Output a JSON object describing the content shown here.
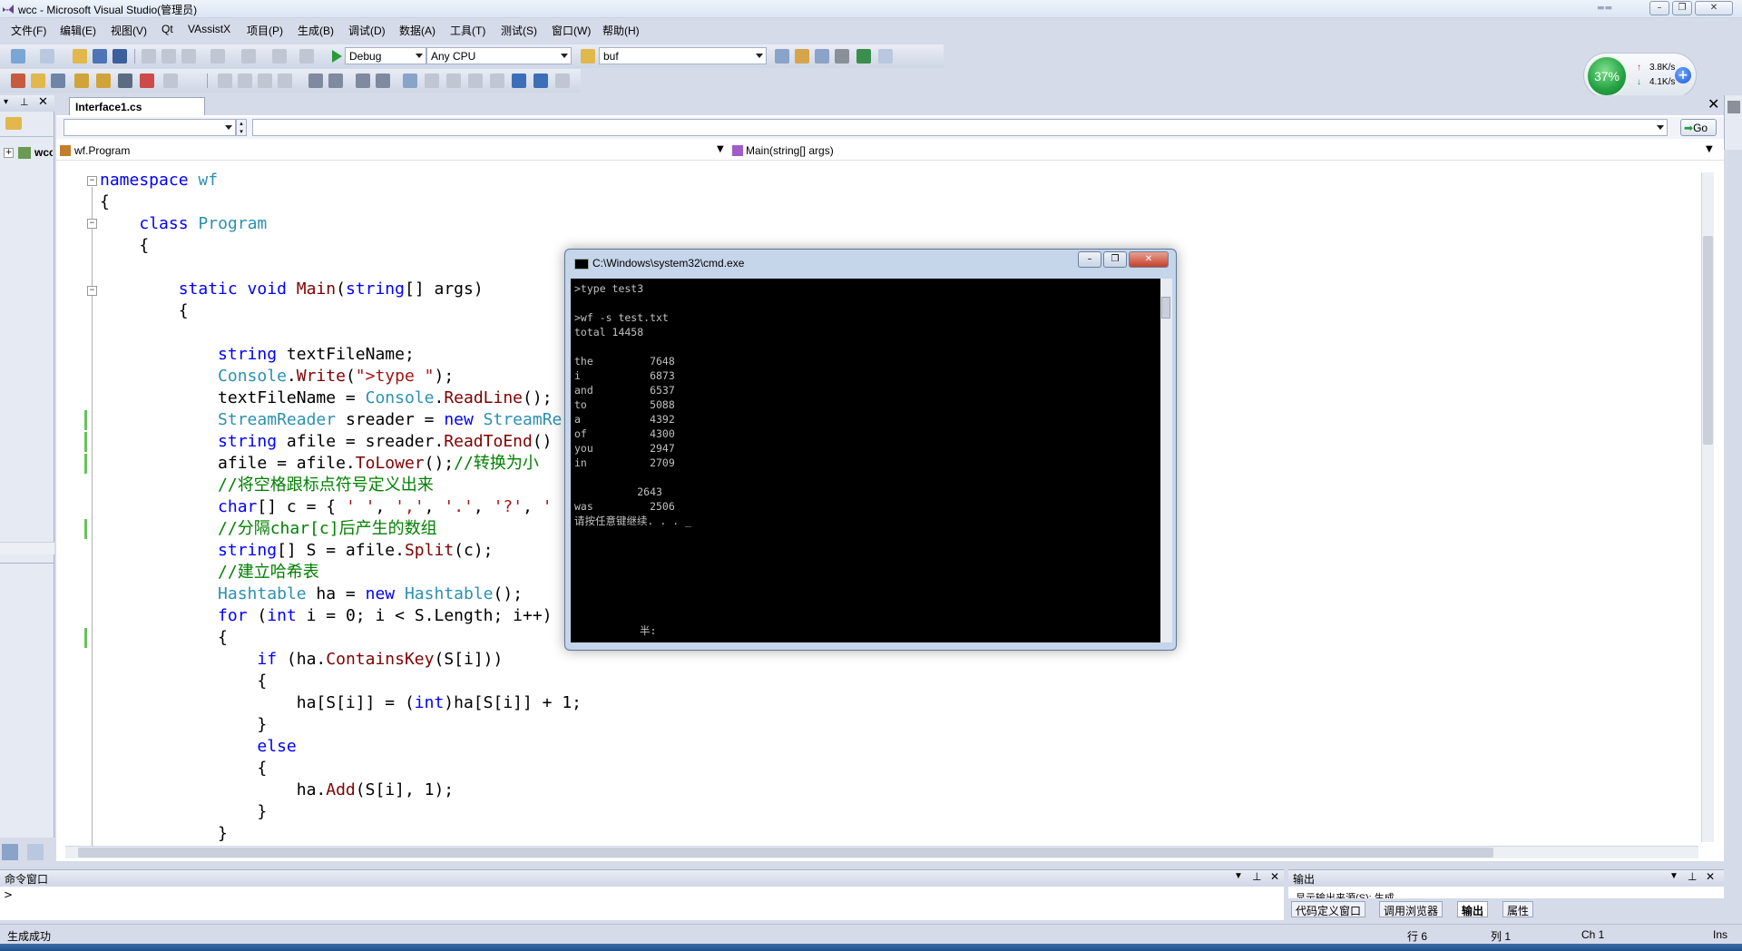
{
  "window": {
    "title": "wcc - Microsoft Visual Studio(管理员)"
  },
  "menu": [
    "文件(F)",
    "编辑(E)",
    "视图(V)",
    "Qt",
    "VAssistX",
    "项目(P)",
    "生成(B)",
    "调试(D)",
    "数据(A)",
    "工具(T)",
    "测试(S)",
    "窗口(W)",
    "帮助(H)"
  ],
  "toolbar": {
    "config": "Debug",
    "platform": "Any CPU",
    "find_value": "buf"
  },
  "gauge": {
    "percent": "37%",
    "upload": "3.8K/s",
    "download": "4.1K/s"
  },
  "editor": {
    "tab": "Interface1.cs",
    "class_combo": "wf.Program",
    "member_combo": "Main(string[] args)",
    "go_label": "Go"
  },
  "solution": {
    "root_label": "wcc"
  },
  "code_lines": [
    [
      [
        "kw",
        "namespace "
      ],
      [
        "ty",
        "wf"
      ]
    ],
    [
      [
        "pl",
        "{"
      ]
    ],
    [
      [
        "pl",
        "    "
      ],
      [
        "kw",
        "class "
      ],
      [
        "ty",
        "Program"
      ]
    ],
    [
      [
        "pl",
        "    {"
      ]
    ],
    [
      [
        "pl",
        ""
      ]
    ],
    [
      [
        "pl",
        "        "
      ],
      [
        "kw",
        "static void "
      ],
      [
        "fn",
        "Main"
      ],
      [
        "pl",
        "("
      ],
      [
        "kw",
        "string"
      ],
      [
        "pl",
        "[] args)"
      ]
    ],
    [
      [
        "pl",
        "        {"
      ]
    ],
    [
      [
        "pl",
        ""
      ]
    ],
    [
      [
        "pl",
        "            "
      ],
      [
        "kw",
        "string "
      ],
      [
        "pl",
        "textFileName;"
      ]
    ],
    [
      [
        "pl",
        "            "
      ],
      [
        "ty",
        "Console"
      ],
      [
        "pl",
        "."
      ],
      [
        "fn",
        "Write"
      ],
      [
        "pl",
        "("
      ],
      [
        "st",
        "\">type \""
      ],
      [
        "pl",
        ");"
      ]
    ],
    [
      [
        "pl",
        "            textFileName = "
      ],
      [
        "ty",
        "Console"
      ],
      [
        "pl",
        "."
      ],
      [
        "fn",
        "ReadLine"
      ],
      [
        "pl",
        "();"
      ]
    ],
    [
      [
        "pl",
        "            "
      ],
      [
        "ty",
        "StreamReader "
      ],
      [
        "pl",
        "sreader = "
      ],
      [
        "kw",
        "new "
      ],
      [
        "ty",
        "StreamRe"
      ]
    ],
    [
      [
        "pl",
        "            "
      ],
      [
        "kw",
        "string "
      ],
      [
        "pl",
        "afile = sreader."
      ],
      [
        "fn",
        "ReadToEnd"
      ],
      [
        "pl",
        "()"
      ]
    ],
    [
      [
        "pl",
        "            afile = afile."
      ],
      [
        "fn",
        "ToLower"
      ],
      [
        "pl",
        "();"
      ],
      [
        "cm",
        "//转换为小"
      ]
    ],
    [
      [
        "pl",
        "            "
      ],
      [
        "cm",
        "//将空格跟标点符号定义出来"
      ]
    ],
    [
      [
        "pl",
        "            "
      ],
      [
        "kw",
        "char"
      ],
      [
        "pl",
        "[] c = { "
      ],
      [
        "st",
        "' '"
      ],
      [
        "pl",
        ", "
      ],
      [
        "st",
        "','"
      ],
      [
        "pl",
        ", "
      ],
      [
        "st",
        "'.'"
      ],
      [
        "pl",
        ", "
      ],
      [
        "st",
        "'?'"
      ],
      [
        "pl",
        ", "
      ],
      [
        "st",
        "'"
      ]
    ],
    [
      [
        "pl",
        "            "
      ],
      [
        "cm",
        "//分隔char[c]后产生的数组"
      ]
    ],
    [
      [
        "pl",
        "            "
      ],
      [
        "kw",
        "string"
      ],
      [
        "pl",
        "[] S = afile."
      ],
      [
        "fn",
        "Split"
      ],
      [
        "pl",
        "(c);"
      ]
    ],
    [
      [
        "pl",
        "            "
      ],
      [
        "cm",
        "//建立哈希表"
      ]
    ],
    [
      [
        "pl",
        "            "
      ],
      [
        "ty",
        "Hashtable "
      ],
      [
        "pl",
        "ha = "
      ],
      [
        "kw",
        "new "
      ],
      [
        "ty",
        "Hashtable"
      ],
      [
        "pl",
        "();"
      ]
    ],
    [
      [
        "pl",
        "            "
      ],
      [
        "kw",
        "for "
      ],
      [
        "pl",
        "("
      ],
      [
        "kw",
        "int "
      ],
      [
        "pl",
        "i = 0; i < S.Length; i++)"
      ]
    ],
    [
      [
        "pl",
        "            {"
      ]
    ],
    [
      [
        "pl",
        "                "
      ],
      [
        "kw",
        "if "
      ],
      [
        "pl",
        "(ha."
      ],
      [
        "fn",
        "ContainsKey"
      ],
      [
        "pl",
        "(S[i]))"
      ]
    ],
    [
      [
        "pl",
        "                {"
      ]
    ],
    [
      [
        "pl",
        "                    ha[S[i]] = ("
      ],
      [
        "kw",
        "int"
      ],
      [
        "pl",
        ")ha[S[i]] + 1;"
      ]
    ],
    [
      [
        "pl",
        "                }"
      ]
    ],
    [
      [
        "pl",
        "                "
      ],
      [
        "kw",
        "else"
      ]
    ],
    [
      [
        "pl",
        "                {"
      ]
    ],
    [
      [
        "pl",
        "                    ha."
      ],
      [
        "fn",
        "Add"
      ],
      [
        "pl",
        "(S[i], 1);"
      ]
    ],
    [
      [
        "pl",
        "                }"
      ]
    ],
    [
      [
        "pl",
        "            }"
      ]
    ]
  ],
  "cmd": {
    "title": "C:\\Windows\\system32\\cmd.exe",
    "lines": [
      ">type test3",
      "",
      ">wf -s test.txt",
      "total 14458",
      "",
      "the         7648",
      "i           6873",
      "and         6537",
      "to          5088",
      "a           4392",
      "of          4300",
      "you         2947",
      "in          2709",
      "",
      "          2643",
      "was         2506",
      "请按任意键继续. . . _"
    ],
    "ime": "半:"
  },
  "command_window": {
    "title": "命令窗口",
    "prompt": ">"
  },
  "output_window": {
    "title": "输出",
    "source_hint": "显示输出来源(S): 生成",
    "tabs": [
      "代码定义窗口",
      "调用浏览器",
      "输出",
      "属性"
    ]
  },
  "status": {
    "left": "生成成功",
    "row": "行 6",
    "col": "列 1",
    "ch": "Ch 1",
    "mode": "Ins"
  }
}
